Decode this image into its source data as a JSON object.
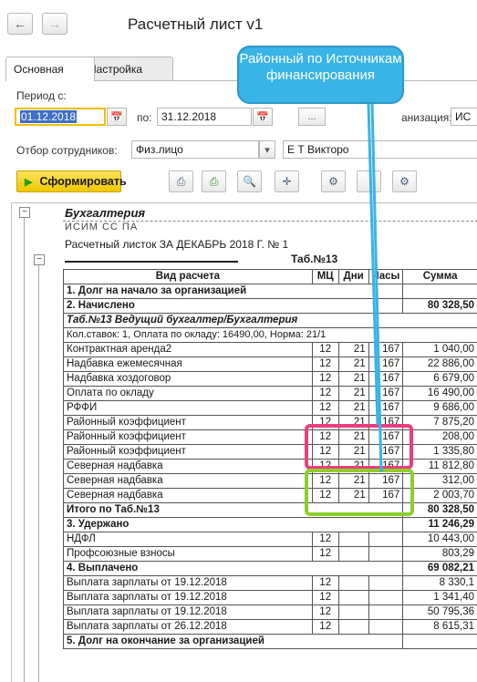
{
  "window": {
    "title": "Расчетный лист v1",
    "back_icon": "arrow-left-icon",
    "forward_icon": "arrow-right-icon"
  },
  "tabs": [
    {
      "label": "Основная",
      "active": true
    },
    {
      "label": "Настройка",
      "active": false
    }
  ],
  "form": {
    "period_label": "Период с:",
    "period_from": "01.12.2018",
    "period_to_label": "по:",
    "period_to": "31.12.2018",
    "ellipsis_button": "...",
    "org_label": "анизация:",
    "org_value": "ИС",
    "filter_label": "Отбор сотрудников:",
    "filter_type": "Физ.лицо",
    "filter_value": "Е          Т        Викторо"
  },
  "toolbar": {
    "generate_label": "Сформировать",
    "buttons": [
      "print-icon",
      "print-preview-icon",
      "preview-icon",
      "move-icon",
      "settings-folder-icon",
      "blank-button",
      "settings-icon"
    ]
  },
  "callout": {
    "text": "Районный по Источникам финансирования"
  },
  "report": {
    "section_title": "Бухгалтерия",
    "org_line": "ИСИМ СС ПА",
    "sheet_title": "Расчетный листок ЗА ДЕКАБРЬ 2018 Г.  № 1",
    "employee_line": "Таб.№13",
    "columns": [
      "Вид расчета",
      "МЦ",
      "Дни",
      "Часы",
      "Сумма"
    ],
    "rows": [
      {
        "style": "b",
        "cells": [
          "1. Долг на начало за организацией",
          "",
          "",
          "",
          ""
        ]
      },
      {
        "style": "b",
        "cells": [
          "2. Начислено",
          "",
          "",
          "",
          "80 328,50"
        ]
      },
      {
        "style": "bi",
        "cells": [
          "Таб.№13 Ведущий бухгалтер/Бухгалтерия",
          "",
          "",
          "",
          ""
        ]
      },
      {
        "style": "note",
        "cells": [
          "Кол.ставок: 1, Оплата по окладу: 16490,00, Норма: 21/1",
          "",
          "",
          "",
          ""
        ]
      },
      {
        "style": "",
        "cells": [
          "Контрактная аренда2",
          "12",
          "21",
          "167",
          "1 040,00"
        ]
      },
      {
        "style": "",
        "cells": [
          "Надбавка ежемесячная",
          "12",
          "21",
          "167",
          "22 886,00"
        ]
      },
      {
        "style": "",
        "cells": [
          "Надбавка хоздоговор",
          "12",
          "21",
          "167",
          "6 679,00"
        ]
      },
      {
        "style": "",
        "cells": [
          "Оплата по окладу",
          "12",
          "21",
          "167",
          "16 490,00"
        ]
      },
      {
        "style": "",
        "cells": [
          "РФФИ",
          "12",
          "21",
          "167",
          "9 686,00"
        ]
      },
      {
        "style": "",
        "cells": [
          "Районный коэффициент",
          "12",
          "21",
          "167",
          "7 875,20"
        ]
      },
      {
        "style": "",
        "cells": [
          "Районный коэффициент",
          "12",
          "21",
          "167",
          "208,00"
        ]
      },
      {
        "style": "",
        "cells": [
          "Районный коэффициент",
          "12",
          "21",
          "167",
          "1 335,80"
        ]
      },
      {
        "style": "",
        "cells": [
          "Северная надбавка",
          "12",
          "21",
          "167",
          "11 812,80"
        ]
      },
      {
        "style": "",
        "cells": [
          "Северная надбавка",
          "12",
          "21",
          "167",
          "312,00"
        ]
      },
      {
        "style": "",
        "cells": [
          "Северная надбавка",
          "12",
          "21",
          "167",
          "2 003,70"
        ]
      },
      {
        "style": "b",
        "cells": [
          "Итого по Таб.№13",
          "",
          "",
          "",
          "80 328,50"
        ]
      },
      {
        "style": "b",
        "cells": [
          "3. Удержано",
          "",
          "",
          "",
          "11 246,29"
        ]
      },
      {
        "style": "",
        "cells": [
          "НДФЛ",
          "12",
          "",
          "",
          "10 443,00"
        ]
      },
      {
        "style": "",
        "cells": [
          "Профсоюзные взносы",
          "12",
          "",
          "",
          "803,29"
        ]
      },
      {
        "style": "b",
        "cells": [
          "4. Выплачено",
          "",
          "",
          "",
          "69 082,21"
        ]
      },
      {
        "style": "",
        "cells": [
          "Выплата зарплаты от 19.12.2018",
          "12",
          "",
          "",
          "8 330,1"
        ]
      },
      {
        "style": "",
        "cells": [
          "Выплата зарплаты от 19.12.2018",
          "12",
          "",
          "",
          "1 341,40"
        ]
      },
      {
        "style": "",
        "cells": [
          "Выплата зарплаты от 19.12.2018",
          "12",
          "",
          "",
          "50 795,36"
        ]
      },
      {
        "style": "",
        "cells": [
          "Выплата зарплаты от 26.12.2018",
          "12",
          "",
          "",
          "8 615,31"
        ]
      },
      {
        "style": "b",
        "cells": [
          "5. Долг на окончание за организацией",
          "",
          "",
          "",
          ""
        ]
      }
    ]
  },
  "colors": {
    "accent_yellow": "#f0c800",
    "callout_blue": "#39b4e6",
    "highlight_pink": "#ec3d7f",
    "highlight_green": "#8ccf2a",
    "selection_blue": "#3e6fc6"
  }
}
